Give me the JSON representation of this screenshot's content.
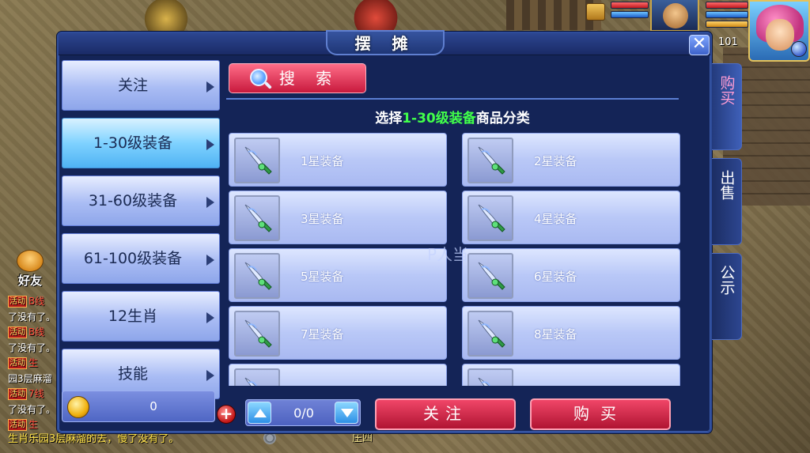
{
  "hud": {
    "player_level": "101",
    "hp_fraction": 1.0,
    "mp_fraction": 1.0
  },
  "panel": {
    "title": "摆 摊",
    "close_symbol": "✕"
  },
  "categories": [
    {
      "label": "关注",
      "active": false
    },
    {
      "label": "1-30级装备",
      "active": true
    },
    {
      "label": "31-60级装备",
      "active": false
    },
    {
      "label": "61-100级装备",
      "active": false
    },
    {
      "label": "12生肖",
      "active": false
    },
    {
      "label": "技能",
      "active": false
    }
  ],
  "search": {
    "label": "搜 索",
    "icon": "magnify-icon"
  },
  "heading": {
    "prefix": "选择",
    "highlight": "1-30级装备",
    "suffix": "商品分类"
  },
  "items": [
    {
      "name": "1星装备",
      "icon": "sword-icon"
    },
    {
      "name": "2星装备",
      "icon": "sword-icon"
    },
    {
      "name": "3星装备",
      "icon": "sword-icon"
    },
    {
      "name": "4星装备",
      "icon": "sword-icon"
    },
    {
      "name": "5星装备",
      "icon": "sword-icon"
    },
    {
      "name": "6星装备",
      "icon": "sword-icon"
    },
    {
      "name": "7星装备",
      "icon": "sword-icon"
    },
    {
      "name": "8星装备",
      "icon": "sword-icon"
    },
    {
      "name": "",
      "icon": "sword-icon"
    },
    {
      "name": "",
      "icon": "sword-icon"
    }
  ],
  "watermark": "P人当",
  "footer": {
    "money": "0",
    "page": "0/0",
    "follow_label": "关注",
    "buy_label": "购买"
  },
  "side_tabs": [
    {
      "label": "购买",
      "active": true
    },
    {
      "label": "出售",
      "active": false
    },
    {
      "label": "公示",
      "active": false
    }
  ],
  "left_hud": {
    "friends_label": "好友",
    "chat": [
      {
        "tag": "活动",
        "text": "B线"
      },
      {
        "tag": "",
        "text": "了没有了。"
      },
      {
        "tag": "活动",
        "text": "B线"
      },
      {
        "tag": "",
        "text": "了没有了。"
      },
      {
        "tag": "活动",
        "text": "生"
      },
      {
        "tag": "",
        "text": "园3层麻溜"
      },
      {
        "tag": "活动",
        "text": "7线"
      },
      {
        "tag": "",
        "text": "了没有了。"
      },
      {
        "tag": "活动",
        "text": "生"
      }
    ],
    "chat_bottom": "生肖乐园3层麻溜的去，慢了没有了。",
    "location": "庄四"
  }
}
